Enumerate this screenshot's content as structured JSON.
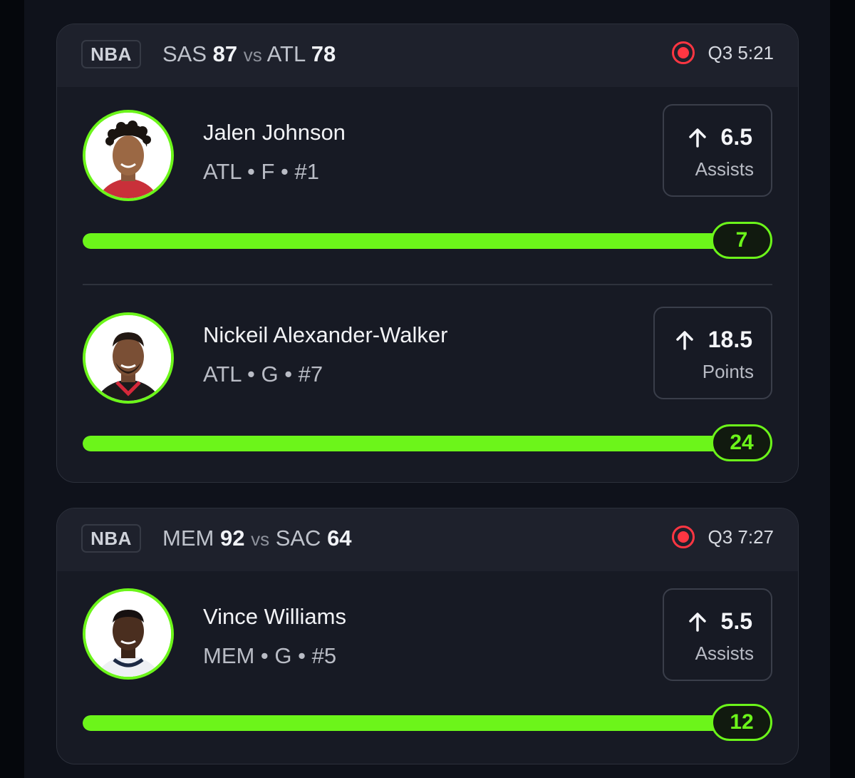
{
  "games": [
    {
      "league": "NBA",
      "team1": "SAS",
      "score1": "87",
      "vs": "vs",
      "team2": "ATL",
      "score2": "78",
      "clock": "Q3 5:21",
      "players": [
        {
          "name": "Jalen Johnson",
          "meta": "ATL • F • #1",
          "line": "6.5",
          "stat": "Assists",
          "value": "7",
          "progress": 1.0
        },
        {
          "name": "Nickeil Alexander-Walker",
          "meta": "ATL • G • #7",
          "line": "18.5",
          "stat": "Points",
          "value": "24",
          "progress": 1.0
        }
      ]
    },
    {
      "league": "NBA",
      "team1": "MEM",
      "score1": "92",
      "vs": "vs",
      "team2": "SAC",
      "score2": "64",
      "clock": "Q3 7:27",
      "players": [
        {
          "name": "Vince Williams",
          "meta": "MEM • G • #5",
          "line": "5.5",
          "stat": "Assists",
          "value": "12",
          "progress": 1.0
        }
      ]
    }
  ],
  "colors": {
    "accent": "#6cf51a",
    "live": "#ff3642",
    "background": "#0f121b",
    "card": "#171a24"
  },
  "icons": {
    "live": "live-record-icon",
    "over": "arrow-up-icon"
  }
}
